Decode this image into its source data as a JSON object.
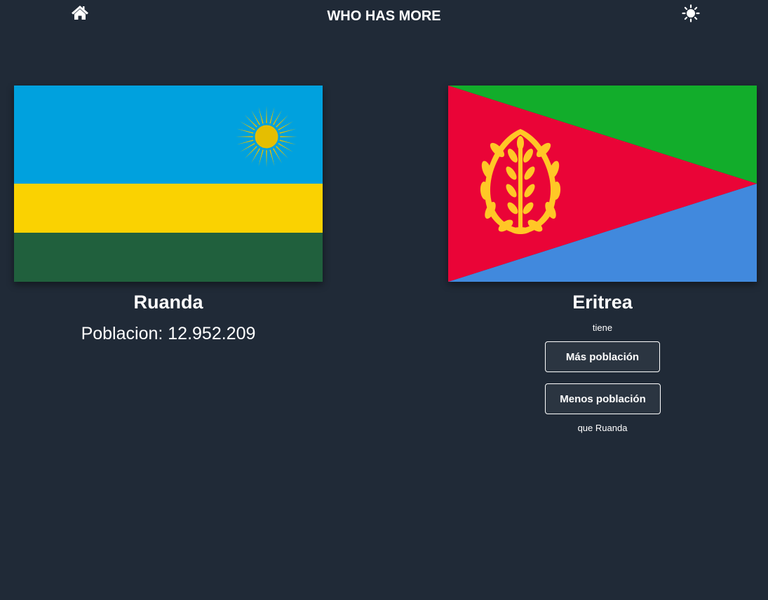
{
  "header": {
    "title": "WHO HAS MORE",
    "home_icon": "home-icon",
    "theme_icon": "sun-icon"
  },
  "left_country": {
    "name": "Ruanda",
    "population_label": "Poblacion: 12.952.209",
    "flag": "rwanda-flag",
    "flag_colors": [
      "#00a1de",
      "#fad201",
      "#20603d",
      "#e5be01"
    ]
  },
  "right_country": {
    "name": "Eritrea",
    "flag": "eritrea-flag",
    "flag_colors": [
      "#12ad2b",
      "#ea0437",
      "#4189dd",
      "#ffc726"
    ]
  },
  "question": {
    "prefix": "tiene",
    "more_button": "Más población",
    "less_button": "Menos población",
    "suffix": "que Ruanda"
  },
  "colors": {
    "background": "#202a37",
    "button_background": "#2b3541",
    "text": "#ffffff"
  }
}
